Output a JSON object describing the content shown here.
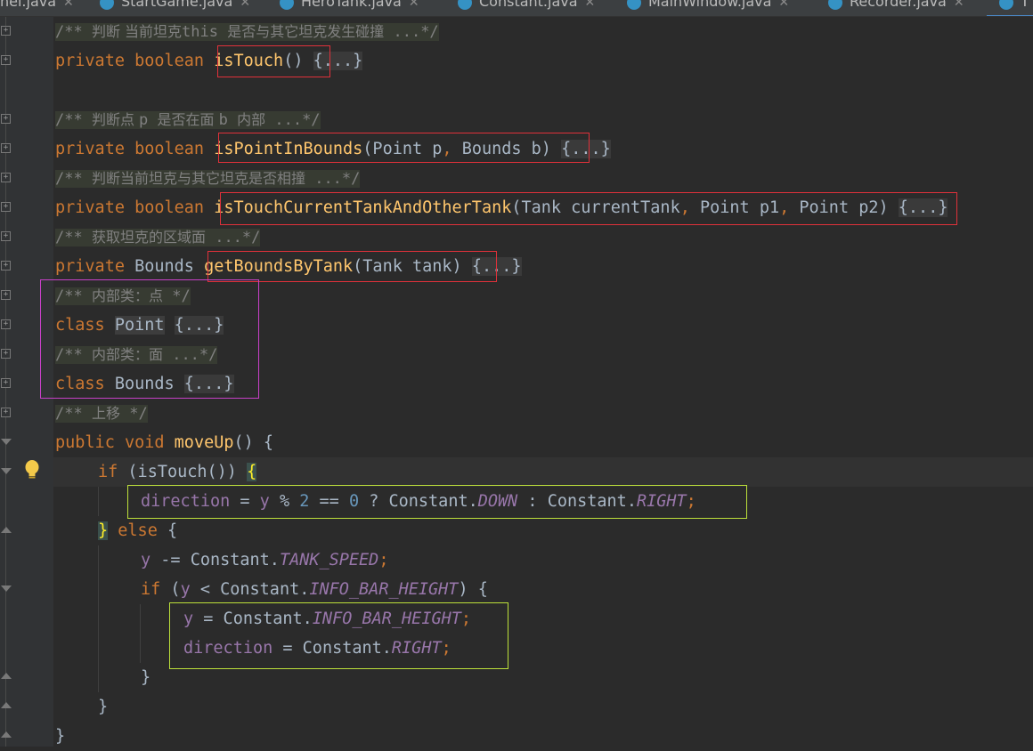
{
  "tabs": [
    {
      "label": "nel.java"
    },
    {
      "label": "StartGame.java"
    },
    {
      "label": "HeroTank.java"
    },
    {
      "label": "Constant.java"
    },
    {
      "label": "MainWindow.java"
    },
    {
      "label": "Recorder.java"
    },
    {
      "label": "T"
    }
  ],
  "colors": {
    "keyword": "#cc7832",
    "method": "#ffc66d",
    "field": "#9876aa",
    "number": "#6897bb",
    "comment": "#808080",
    "text": "#a9b7c6",
    "annotation_red": "#e0313a",
    "annotation_magenta": "#c840c8",
    "annotation_green": "#bde03a"
  },
  "code": {
    "l1": {
      "c1": "/** ",
      "zh": "判断 当前坦克",
      "c2": "this ",
      "zh2": "是否与其它坦克发生碰撞",
      "c3": " ...*/"
    },
    "l2": {
      "kw": "private boolean ",
      "fn": "isTouch",
      "params": "()",
      "fold": "{...}"
    },
    "l4": {
      "c1": "/** ",
      "zh": "判断点 ",
      "c2": "p ",
      "zh2": "是否在面 ",
      "c3": "b ",
      "zh3": "内部",
      "c4": " ...*/"
    },
    "l5": {
      "kw": "private boolean ",
      "fn": "isPointInBounds",
      "p1": "(Point p",
      "comma": ", ",
      "p2": "Bounds b)",
      "fold": "{...}"
    },
    "l6": {
      "c1": "/** ",
      "zh": "判断当前坦克与其它坦克是否相撞",
      "c2": " ...*/"
    },
    "l7": {
      "kw": "private boolean ",
      "fn": "isTouchCurrentTankAndOtherTank",
      "p1": "(Tank currentTank",
      "comma1": ", ",
      "p2": "Point p1",
      "comma2": ", ",
      "p3": "Point p2)",
      "fold": "{...}"
    },
    "l8": {
      "c1": "/** ",
      "zh": "获取坦克的区域面",
      "c2": " ...*/"
    },
    "l9": {
      "kw": "private ",
      "type": "Bounds ",
      "fn": "getBoundsByTank",
      "params": "(Tank tank)",
      "fold": "{...}"
    },
    "l10": {
      "c1": "/** ",
      "zh": "内部类：点",
      "c2": " */"
    },
    "l11": {
      "kw": "class ",
      "name": "Point",
      "fold": "{...}"
    },
    "l12": {
      "c1": "/** ",
      "zh": "内部类：面",
      "c2": " ...*/"
    },
    "l13": {
      "kw": "class ",
      "name": "Bounds",
      "fold": "{...}"
    },
    "l14": {
      "c1": "/** ",
      "zh": "上移",
      "c2": " */"
    },
    "l15": {
      "kw1": "public ",
      "kw2": "void ",
      "fn": "moveUp",
      "rest": "() {"
    },
    "l16": {
      "kw": "if ",
      "mid": "(isTouch()) ",
      "brace": "{"
    },
    "l17": {
      "f1": "direction",
      "op1": " = ",
      "f2": "y",
      "op2": " % ",
      "n1": "2",
      "op3": " == ",
      "n2": "0",
      "op4": " ? Constant.",
      "c1": "DOWN",
      "op5": " : Constant.",
      "c2": "RIGHT",
      "semi": ";"
    },
    "l18": {
      "brace": "}",
      "kw": " else",
      "rest": " {"
    },
    "l19": {
      "f": "y",
      "op": " -= Constant.",
      "c": "TANK_SPEED",
      "semi": ";"
    },
    "l20": {
      "kw": "if ",
      "p": "(",
      "f": "y",
      "op": " < Constant.",
      "c": "INFO_BAR_HEIGHT",
      "rest": ") {"
    },
    "l21": {
      "f": "y",
      "op": " = Constant.",
      "c": "INFO_BAR_HEIGHT",
      "semi": ";"
    },
    "l22": {
      "f": "direction",
      "op": " = Constant.",
      "c": "RIGHT",
      "semi": ";"
    },
    "l23": {
      "t": "}"
    },
    "l24": {
      "t": "}"
    },
    "l25": {
      "t": "}"
    }
  }
}
